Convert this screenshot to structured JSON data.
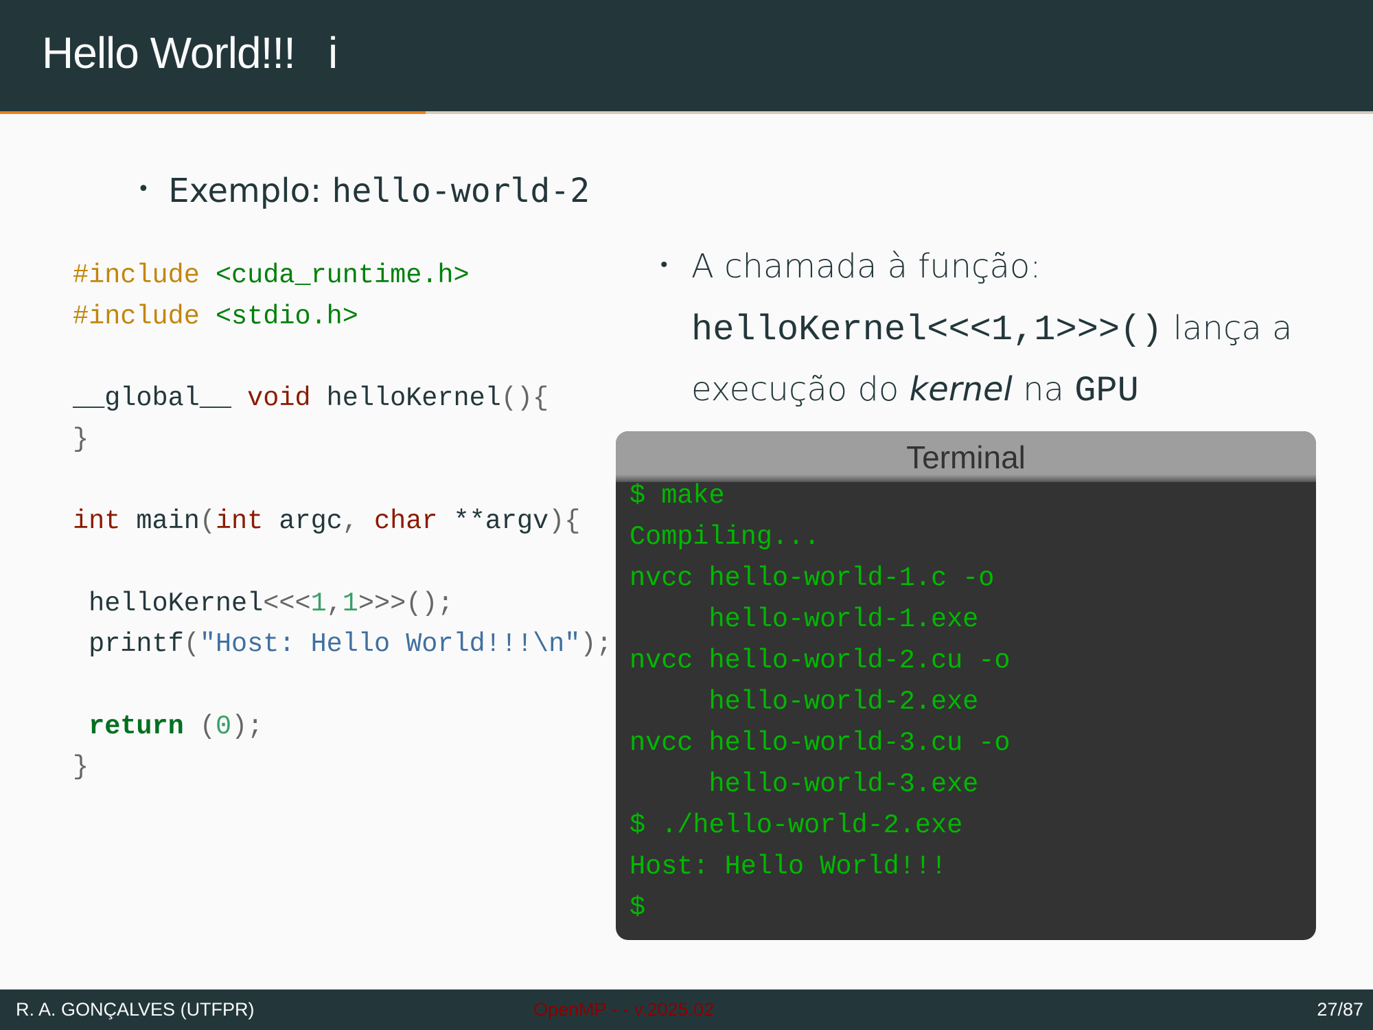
{
  "header": {
    "title": "Hello World!!!",
    "indicator": "i"
  },
  "colors": {
    "header_bg": "#23373b",
    "progress": "#eb811b",
    "terminal_text": "#00b800",
    "footer_center": "#8b0000"
  },
  "progress": 0.31,
  "bullet1": {
    "label": "Exemplo:",
    "code": "hello-world-2"
  },
  "code": [
    [
      {
        "t": "#include",
        "c": "pp"
      },
      {
        "t": " "
      },
      {
        "t": "<cuda_runtime.h>",
        "c": "inc"
      }
    ],
    [
      {
        "t": "#include",
        "c": "pp"
      },
      {
        "t": " "
      },
      {
        "t": "<stdio.h>",
        "c": "inc"
      }
    ],
    [],
    [
      {
        "t": "__global__ "
      },
      {
        "t": "void",
        "c": "kw"
      },
      {
        "t": " helloKernel"
      },
      {
        "t": "(){",
        "c": "pun"
      }
    ],
    [
      {
        "t": "}",
        "c": "pun"
      }
    ],
    [],
    [
      {
        "t": "int",
        "c": "kw"
      },
      {
        "t": " main"
      },
      {
        "t": "(",
        "c": "pun"
      },
      {
        "t": "int",
        "c": "kw"
      },
      {
        "t": " argc"
      },
      {
        "t": ", ",
        "c": "pun"
      },
      {
        "t": "char",
        "c": "kw"
      },
      {
        "t": " **argv"
      },
      {
        "t": "){",
        "c": "pun"
      }
    ],
    [],
    [
      {
        "t": " helloKernel"
      },
      {
        "t": "<<<",
        "c": "pun"
      },
      {
        "t": "1",
        "c": "num"
      },
      {
        "t": ",",
        "c": "pun"
      },
      {
        "t": "1",
        "c": "num"
      },
      {
        "t": ">>>();",
        "c": "pun"
      }
    ],
    [
      {
        "t": " printf"
      },
      {
        "t": "(",
        "c": "pun"
      },
      {
        "t": "\"Host: Hello World!!!\\n\"",
        "c": "str"
      },
      {
        "t": ");",
        "c": "pun"
      }
    ],
    [],
    [
      {
        "t": " "
      },
      {
        "t": "return",
        "c": "ret"
      },
      {
        "t": " (",
        "c": "pun"
      },
      {
        "t": "0",
        "c": "num"
      },
      {
        "t": ");",
        "c": "pun"
      }
    ],
    [
      {
        "t": "}",
        "c": "pun"
      }
    ]
  ],
  "right": {
    "line1": "A chamada à função:",
    "call_code": "helloKernel<<<1,1>>>()",
    "line2_rest": " lança a",
    "line3_a": "execução do ",
    "line3_em": "kernel",
    "line3_b": " na ",
    "line3_gpu": "GPU"
  },
  "terminal": {
    "title": "Terminal",
    "lines": [
      "$ make",
      "Compiling...",
      "nvcc hello-world-1.c -o",
      "     hello-world-1.exe",
      "nvcc hello-world-2.cu -o",
      "     hello-world-2.exe",
      "nvcc hello-world-3.cu -o",
      "     hello-world-3.exe",
      "$ ./hello-world-2.exe",
      "Host: Hello World!!!",
      "$"
    ]
  },
  "footer": {
    "author": "R. A. GONÇALVES  (UTFPR)",
    "center": "OpenMP - - v.2025.02",
    "page": "27/87"
  }
}
